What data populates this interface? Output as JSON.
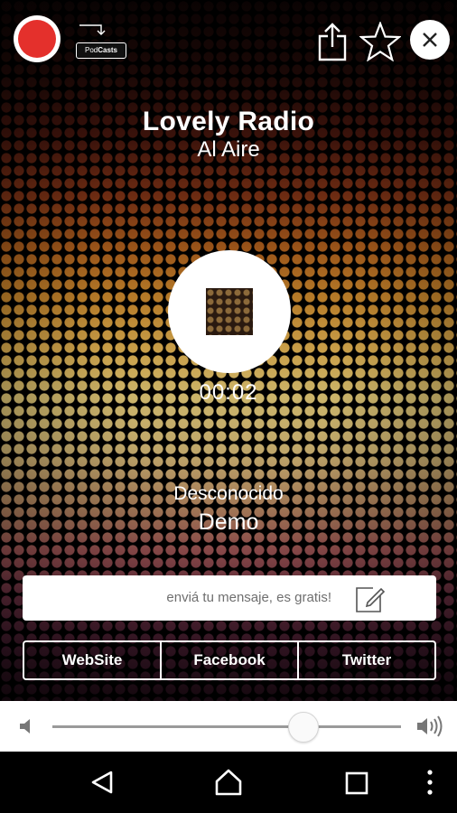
{
  "header": {
    "podcasts_label_prefix": "Pod",
    "podcasts_label_bold": "Casts"
  },
  "station": {
    "name": "Lovely Radio",
    "status": "Al Aire"
  },
  "player": {
    "elapsed": "00:02",
    "artist": "Desconocido",
    "track": "Demo"
  },
  "message": {
    "placeholder": "enviá tu mensaje, es gratis!"
  },
  "links": [
    {
      "label": "WebSite"
    },
    {
      "label": "Facebook"
    },
    {
      "label": "Twitter"
    }
  ],
  "volume": {
    "level": 0.72
  },
  "colors": {
    "record_red": "#e4302c",
    "message_text": "#6f6f6f"
  }
}
